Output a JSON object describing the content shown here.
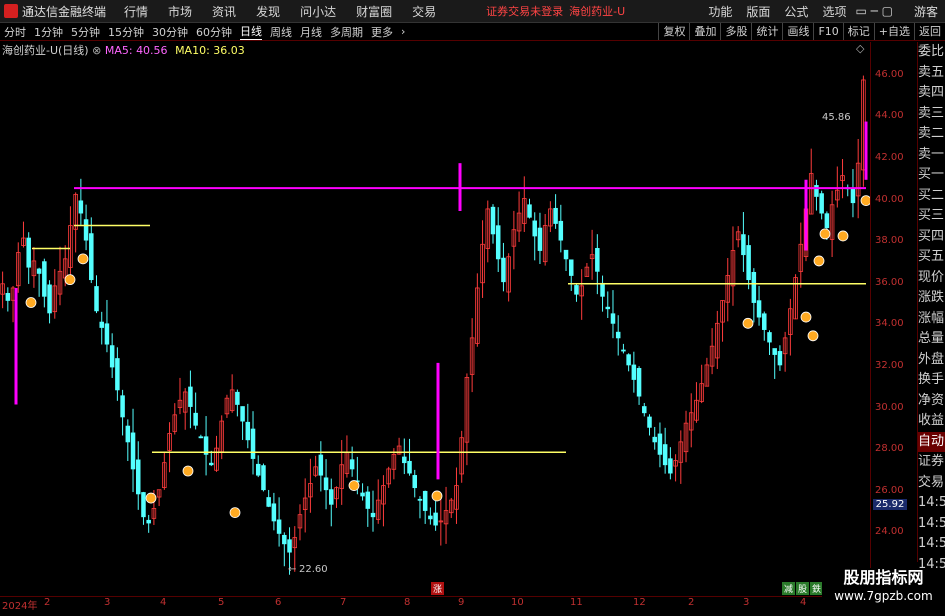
{
  "menubar": {
    "app_title": "通达信金融终端",
    "items": [
      "行情",
      "市场",
      "资讯",
      "发现",
      "问小达",
      "财富圈",
      "交易"
    ],
    "notice": "证券交易未登录",
    "stock": "海创药业-U",
    "right_items": [
      "功能",
      "版面",
      "公式",
      "选项"
    ],
    "user": "游客"
  },
  "toolbar": {
    "periods": [
      "分时",
      "1分钟",
      "5分钟",
      "15分钟",
      "30分钟",
      "60分钟",
      "日线",
      "周线",
      "月线",
      "多周期",
      "更多"
    ],
    "active": "日线",
    "buttons": [
      "复权",
      "叠加",
      "多股",
      "统计",
      "画线",
      "F10",
      "标记",
      "+自选",
      "返回"
    ]
  },
  "indicator": {
    "name": "海创药业-U(日线)",
    "ma5_label": "MA5:",
    "ma5": "40.56",
    "ma10_label": "MA10:",
    "ma10": "36.03"
  },
  "side_labels": [
    "委比",
    "卖五",
    "卖四",
    "卖三",
    "卖二",
    "卖一",
    "买一",
    "买二",
    "买三",
    "买四",
    "买五",
    "现价",
    "涨跌",
    "涨幅",
    "总量",
    "外盘",
    "换手",
    "净资",
    "收益",
    "自动",
    "证券",
    "交易",
    "14:56",
    "14:56",
    "14:56",
    "14:56",
    "14:56",
    "14:56"
  ],
  "side_highlight": "自动",
  "price_axis": [
    "46.00",
    "44.00",
    "42.00",
    "40.00",
    "38.00",
    "36.00",
    "34.00",
    "32.00",
    "30.00",
    "28.00",
    "26.00",
    "24.00"
  ],
  "current_price": "25.92",
  "date_axis": [
    "2024年",
    "2",
    "3",
    "4",
    "5",
    "6",
    "7",
    "8",
    "9",
    "10",
    "11",
    "12",
    "2",
    "3",
    "4"
  ],
  "annotations": {
    "high": "45.86",
    "low": "22.60",
    "zhang_badge": "涨",
    "corner_badges": [
      "减",
      "股",
      "鉄",
      "量"
    ]
  },
  "watermark": {
    "line1": "股朋指标网",
    "line2": "www.7gpzb.com"
  },
  "colors": {
    "up": "#ff3c3c",
    "down": "#54ffff",
    "magenta": "#ff00ff",
    "yellow_line": "#ffff66",
    "signal": "#ffaa22"
  },
  "chart_data": {
    "type": "candlestick",
    "ylim": [
      22,
      47
    ],
    "series_close": [
      36,
      35.2,
      35.8,
      37.5,
      38.2,
      36.8,
      37.1,
      36.5,
      35.4,
      34.6,
      35.9,
      36.6,
      37.2,
      38.8,
      40.3,
      39.4,
      38.1,
      36.2,
      34.7,
      33.9,
      33.1,
      32.0,
      30.9,
      29.6,
      28.4,
      27.1,
      25.9,
      24.8,
      24.5,
      25.2,
      26.1,
      27.4,
      28.8,
      29.7,
      30.4,
      30.8,
      30.1,
      29.2,
      28.6,
      27.8,
      27.3,
      28.1,
      29.4,
      30.5,
      30.9,
      30.2,
      29.4,
      28.5,
      27.6,
      26.8,
      26.1,
      25.3,
      24.6,
      24.0,
      23.5,
      23.1,
      23.8,
      24.9,
      25.7,
      26.4,
      27.2,
      26.8,
      26.1,
      25.4,
      26.2,
      27.3,
      27.9,
      27.1,
      26.5,
      25.8,
      25.2,
      24.8,
      25.6,
      26.3,
      27.1,
      27.8,
      28.2,
      27.4,
      26.9,
      26.2,
      25.6,
      25.1,
      24.7,
      24.4,
      24.6,
      25.1,
      25.6,
      26.3,
      28.6,
      31.5,
      33.4,
      35.8,
      37.9,
      39.6,
      38.4,
      37.2,
      36.1,
      37.3,
      38.6,
      39.4,
      40.1,
      39.2,
      38.3,
      37.6,
      38.8,
      39.6,
      38.9,
      38.1,
      37.2,
      36.4,
      35.5,
      35.9,
      36.8,
      37.4,
      36.6,
      35.4,
      34.8,
      34.1,
      33.4,
      32.8,
      32.1,
      31.4,
      30.6,
      29.8,
      29.1,
      28.4,
      27.8,
      27.3,
      26.9,
      27.5,
      28.4,
      29.3,
      29.8,
      30.4,
      31.2,
      32.1,
      33.0,
      34.1,
      35.2,
      36.4,
      37.6,
      38.5,
      37.4,
      36.2,
      35.1,
      34.4,
      33.8,
      33.2,
      32.6,
      32.1,
      33.4,
      34.8,
      36.3,
      37.9,
      39.6,
      41.3,
      40.2,
      39.4,
      38.7,
      39.8,
      40.5,
      41.2,
      40.6,
      39.9,
      41.8,
      45.8
    ]
  }
}
